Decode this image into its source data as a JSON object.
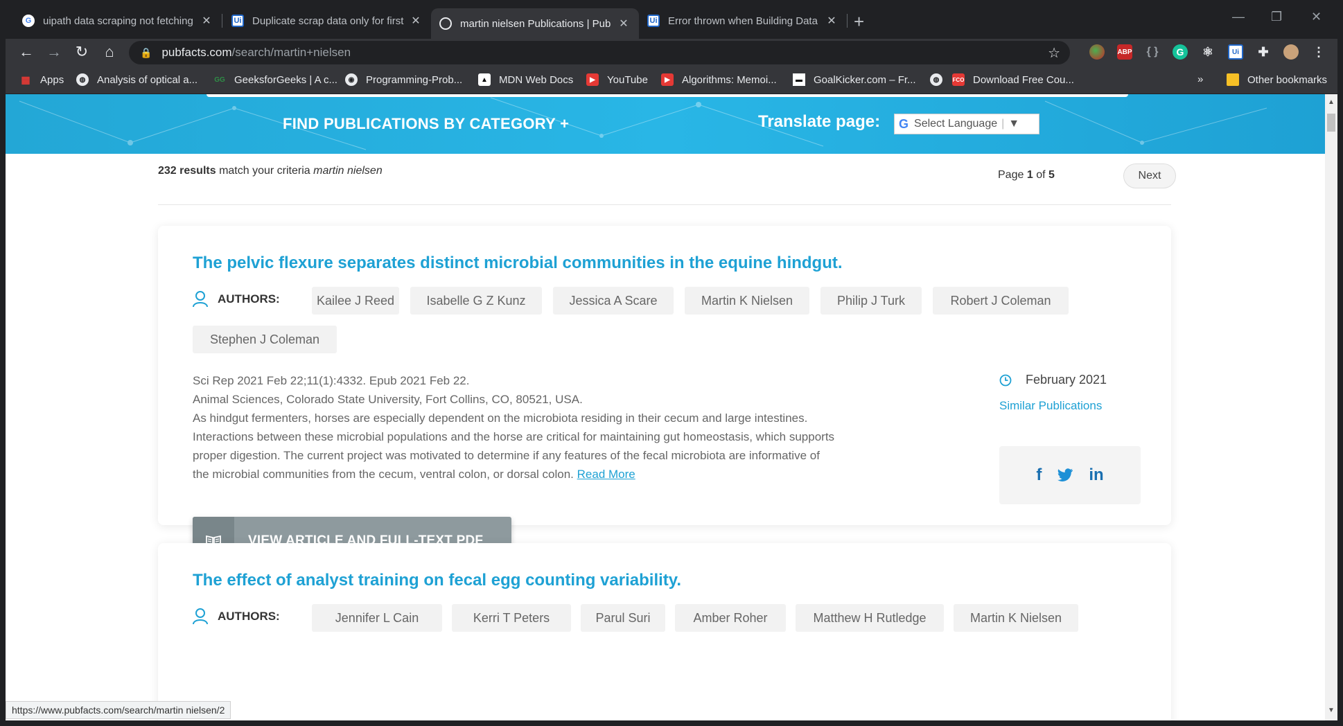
{
  "tabs": [
    {
      "title": "uipath data scraping not fetching",
      "icon": "google-icon"
    },
    {
      "title": "Duplicate scrap data only for first",
      "icon": "uipath-icon"
    },
    {
      "title": "martin nielsen Publications | Pub",
      "icon": "pubfacts-icon"
    },
    {
      "title": "Error thrown when Building Data",
      "icon": "uipath-icon"
    }
  ],
  "address": {
    "domain": "pubfacts.com",
    "path": "/search/martin+nielsen"
  },
  "extensions": {
    "abp": "ABP",
    "uipath": "Ui"
  },
  "bookmarks": {
    "apps": "Apps",
    "items": [
      "Analysis of optical a...",
      "GeeksforGeeks | A c...",
      "Programming-Prob...",
      "MDN Web Docs",
      "YouTube",
      "Algorithms: Memoi...",
      "GoalKicker.com – Fr...",
      "Download Free Cou..."
    ],
    "more": "»",
    "other": "Other bookmarks"
  },
  "banner": {
    "category": "FIND PUBLICATIONS BY CATEGORY +",
    "translate": "Translate page:",
    "select_language": "Select Language"
  },
  "results": {
    "count": "232 results",
    "text": "match your criteria",
    "query": "martin nielsen",
    "page_prefix": "Page",
    "page_current": "1",
    "page_of": "of",
    "page_total": "5",
    "next": "Next"
  },
  "authors_label": "AUTHORS:",
  "publications": [
    {
      "title": "The pelvic flexure separates distinct microbial communities in the equine hindgut.",
      "authors": [
        "Kailee J Reed",
        "Isabelle G Z Kunz",
        "Jessica A Scare",
        "Martin K Nielsen",
        "Philip J Turk",
        "Robert J Coleman",
        "Stephen J Coleman"
      ],
      "citation": "Sci Rep 2021 Feb 22;11(1):4332. Epub 2021 Feb 22.",
      "affiliation": "Animal Sciences, Colorado State University, Fort Collins, CO, 80521, USA.",
      "abstract_1": "As hindgut fermenters, horses are especially dependent on the microbiota residing in their cecum and large intestines.",
      "abstract_2": "Interactions between these microbial populations and the horse are critical for maintaining gut homeostasis, which supports",
      "abstract_3": "proper digestion. The current project was motivated to determine if any features of the fecal microbiota are informative of",
      "abstract_4": "the microbial communities from the cecum, ventral colon, or dorsal colon.",
      "read_more": "Read More",
      "date": "February 2021",
      "similar": "Similar Publications",
      "view_button": "VIEW ARTICLE AND FULL-TEXT PDF"
    },
    {
      "title": "The effect of analyst training on fecal egg counting variability.",
      "authors": [
        "Jennifer L Cain",
        "Kerri T Peters",
        "Parul Suri",
        "Amber Roher",
        "Matthew H Rutledge",
        "Martin K Nielsen"
      ]
    }
  ],
  "share": {
    "facebook": "f",
    "twitter": "t",
    "linkedin": "in"
  },
  "status_url": "https://www.pubfacts.com/search/martin nielsen/2",
  "colors": {
    "accent": "#1ea1d4",
    "banner": "#29b6e6",
    "button": "#8e9a9e",
    "chrome_dark": "#202124",
    "chrome_toolbar": "#35363a"
  }
}
